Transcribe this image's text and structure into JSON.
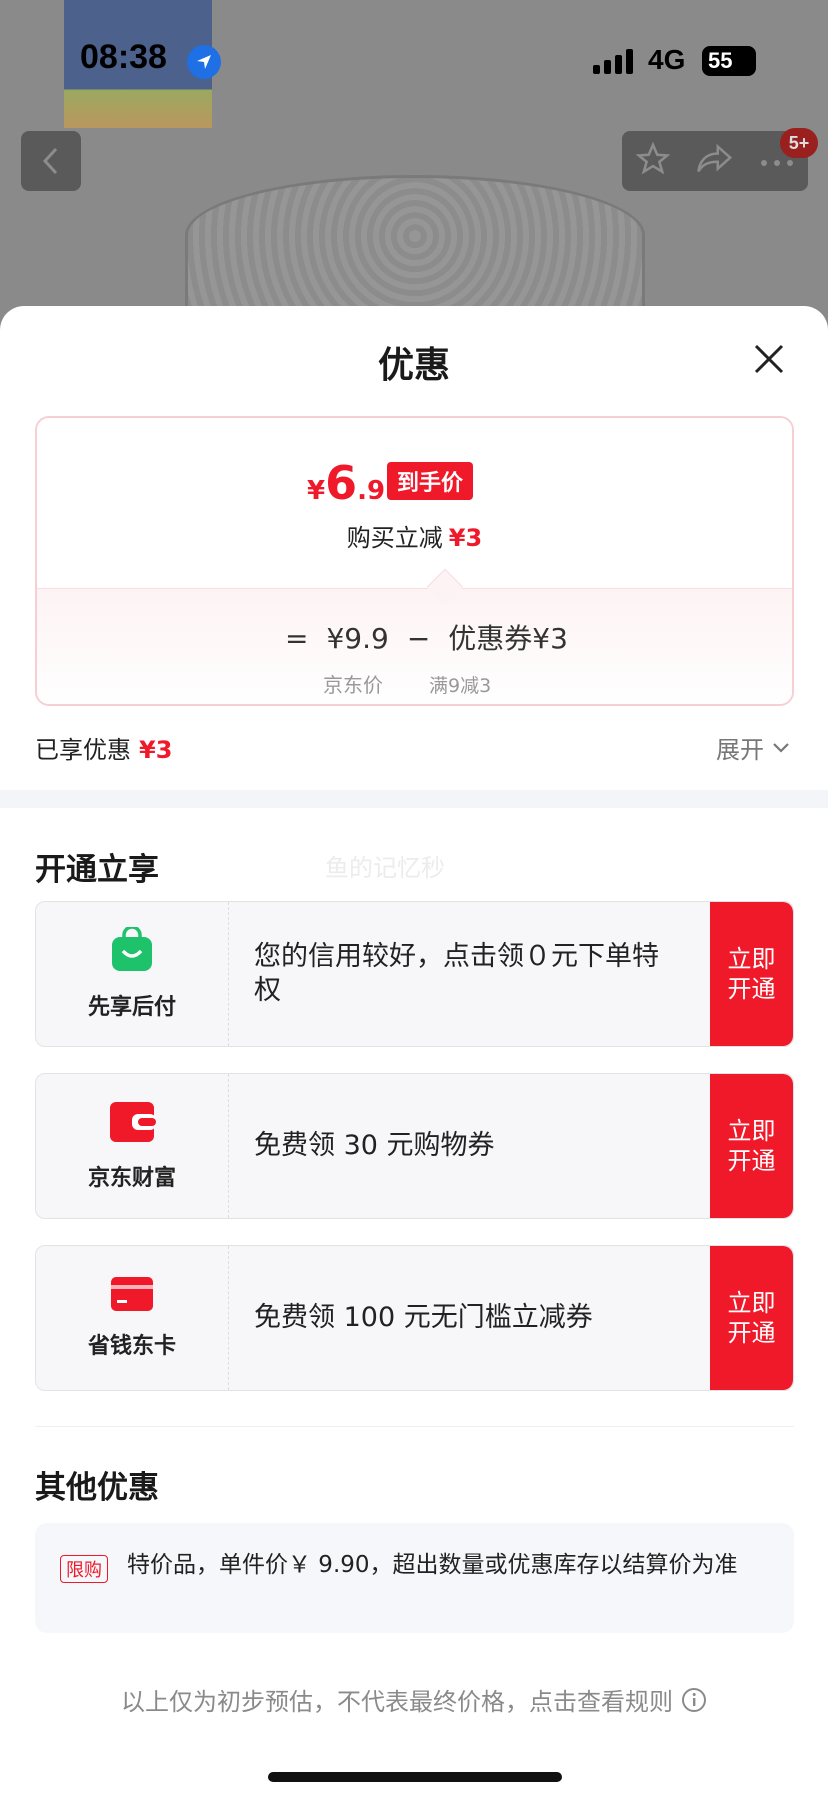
{
  "status_bar": {
    "time": "08:38",
    "network": "4G",
    "battery": "55"
  },
  "top_bar": {
    "badge": "5+"
  },
  "sheet": {
    "title": "优惠",
    "price": {
      "yen": "¥",
      "integer": "6",
      "decimal": ".9",
      "tag": "到手价",
      "instant_label": "购买立减",
      "instant_value": "¥3",
      "equals": "=",
      "jd_price": "¥9.9",
      "minus": "−",
      "coupon": "优惠券¥3",
      "jd_price_label": "京东价",
      "coupon_rule": "满9减3"
    },
    "enjoyed": {
      "label": "已享优惠",
      "value": "¥3",
      "expand": "展开"
    },
    "open_section": {
      "title": "开通立享",
      "watermark": "鱼的记忆秒",
      "items": [
        {
          "name": "先享后付",
          "icon": "shopping-bag-icon",
          "desc": "您的信用较好，点击领０元下单特权",
          "cta": "立即开通",
          "color": "#1ec26a"
        },
        {
          "name": "京东财富",
          "icon": "wallet-icon",
          "desc": "免费领 30 元购物券",
          "cta": "立即开通",
          "color": "#f0192a"
        },
        {
          "name": "省钱东卡",
          "icon": "card-icon",
          "desc": "免费领 100 元无门槛立减券",
          "cta": "立即开通",
          "color": "#f0192a"
        }
      ]
    },
    "other_section": {
      "title": "其他优惠",
      "tag": "限购",
      "text": "特价品，单件价￥ 9.90，超出数量或优惠库存以结算价为准"
    },
    "disclaimer": "以上仅为初步预估，不代表最终价格，点击查看规则"
  },
  "colors": {
    "accent": "#f0192a",
    "green": "#1ec26a"
  }
}
